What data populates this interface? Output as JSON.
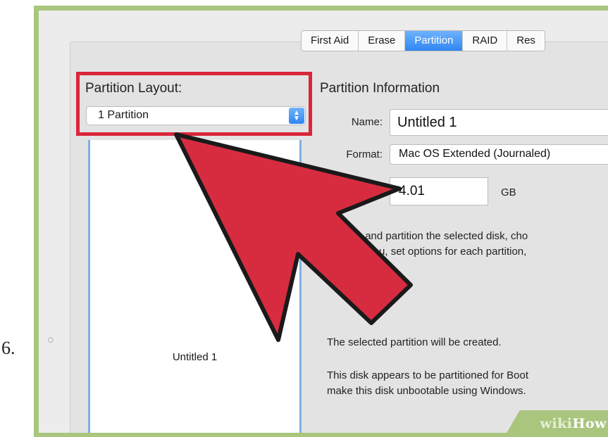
{
  "step_number": "6.",
  "tabs": [
    {
      "label": "First Aid",
      "active": false
    },
    {
      "label": "Erase",
      "active": false
    },
    {
      "label": "Partition",
      "active": true
    },
    {
      "label": "RAID",
      "active": false
    },
    {
      "label": "Res",
      "active": false
    }
  ],
  "partition_layout": {
    "label": "Partition Layout:",
    "selected": "1 Partition",
    "map_label": "Untitled 1"
  },
  "partition_info": {
    "title": "Partition Information",
    "name_label": "Name:",
    "name_value": "Untitled 1",
    "format_label": "Format:",
    "format_value": "Mac OS Extended (Journaled)",
    "size_value": "4.01",
    "size_unit": "GB",
    "description_line1": "o erase and partition the selected disk, cho",
    "description_line2": "up menu, set options for each partition,",
    "status": "The selected partition will be created.",
    "boot_note_line1": "This disk appears to be partitioned for Boot",
    "boot_note_line2": "make this disk unbootable using Windows."
  },
  "watermark": {
    "wiki": "wiki",
    "how": "How"
  },
  "colors": {
    "frame_border": "#a9c57e",
    "highlight": "#d9263a",
    "arrow_fill": "#d72c40",
    "tab_active": "#2f86f4"
  }
}
